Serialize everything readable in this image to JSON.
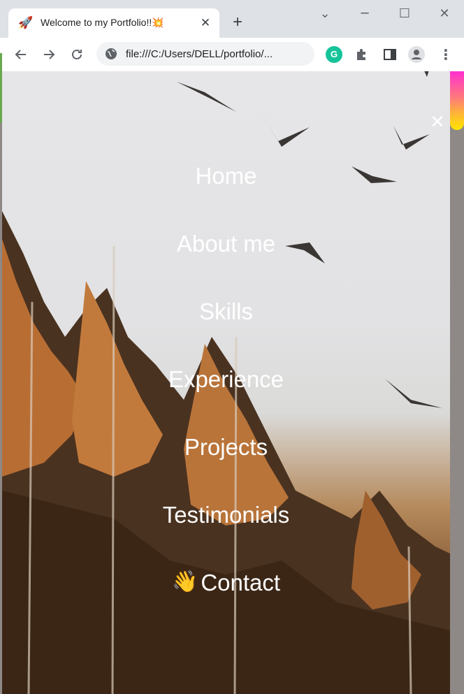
{
  "browser": {
    "tab_title": "Welcome to my Portfolio!!💥",
    "tab_favicon": "🚀",
    "url": "file:///C:/Users/DELL/portfolio/...",
    "grammarly_label": "G"
  },
  "page": {
    "accent_colors": [
      "#ff2fd0",
      "#ffb13b",
      "#ffe600"
    ],
    "menu": {
      "items": [
        {
          "label": "Home"
        },
        {
          "label": "About me"
        },
        {
          "label": "Skills"
        },
        {
          "label": "Experience"
        },
        {
          "label": "Projects"
        },
        {
          "label": "Testimonials"
        },
        {
          "label": "Contact",
          "emoji": "👋"
        }
      ]
    }
  }
}
